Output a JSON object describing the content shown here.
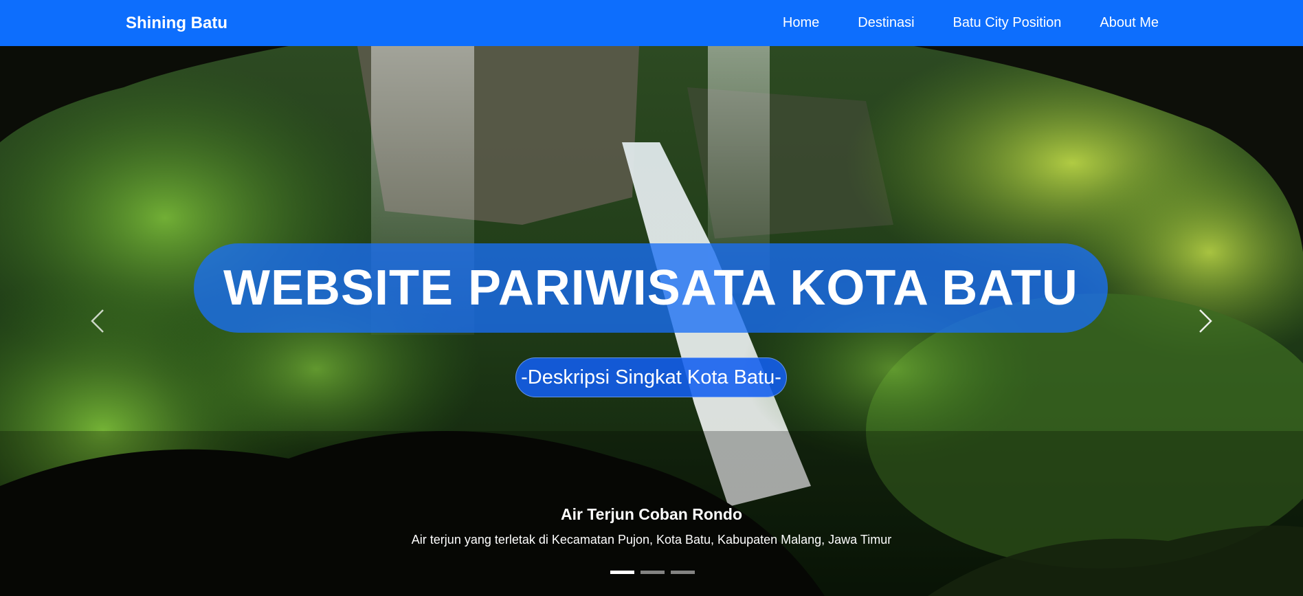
{
  "navbar": {
    "brand": "Shining Batu",
    "links": [
      {
        "label": "Home"
      },
      {
        "label": "Destinasi"
      },
      {
        "label": "Batu City Position"
      },
      {
        "label": "About Me"
      }
    ]
  },
  "hero": {
    "title": "WEBSITE PARIWISATA KOTA BATU",
    "subtitle": "-Deskripsi Singkat Kota Batu-",
    "caption_title": "Air Terjun Coban Rondo",
    "caption_text": "Air terjun yang terletak di Kecamatan Pujon, Kota Batu, Kabupaten Malang, Jawa Timur",
    "prev_icon": "chevron-left-icon",
    "next_icon": "chevron-right-icon",
    "slides_total": 3,
    "active_slide": 1
  },
  "colors": {
    "primary": "#0d6efd",
    "title_pill": "#196ef5",
    "white": "#ffffff"
  }
}
